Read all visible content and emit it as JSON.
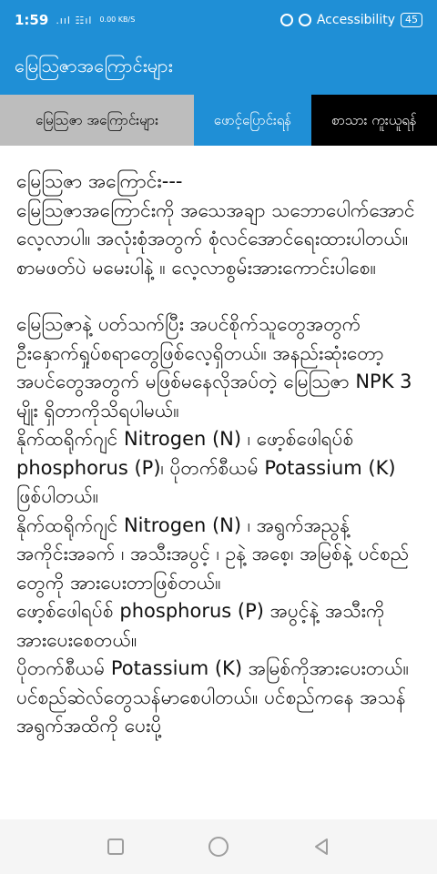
{
  "status_bar": {
    "time": "1:59",
    "signal": ".ııl ☷ıl",
    "speed": "0.00 KB/S",
    "accessibility_label": "Accessibility",
    "battery": "45"
  },
  "app_bar": {
    "title": "မြေဩဇာအကြောင်းများ"
  },
  "tabs": [
    {
      "label": "မြေဩဇာ အကြောင်းများ"
    },
    {
      "label": "ဖောင့်ပြောင်းရန်"
    },
    {
      "label": "စာသား ကူးယူရန်"
    }
  ],
  "article": {
    "paragraphs": [
      "မြေဩဇာ အကြောင်း---",
      "မြေဩဇာအကြောင်းကို အသေအချာ သဘောပေါက်အောင်လေ့လာပါ။ အလုံးစုံအတွက် စုံလင်အောင်ရေးထားပါတယ်။ စာမဖတ်ပဲ မမေးပါနဲ့ ။ လေ့လာစွမ်းအားကောင်းပါစေ။",
      "",
      "မြေဩဇာနဲ့ ပတ်သက်ပြီး အပင်စိုက်သူတွေအတွက် ဦးနှောက်ရှုပ်စရာတွေဖြစ်လေ့ရှိတယ်။ အနည်းဆုံးတော့ အပင်တွေအတွက် မဖြစ်မနေလိုအပ်တဲ့ မြေဩဇာ NPK 3 မျိုး ရှိတာကိုသိရပါမယ်။",
      "နိုက်ထရိုက်ဂျင် Nitrogen (N) ၊ ဖော့စ်ဖေါရပ်စ် phosphorus (P)၊ ပိုတက်စီယမ် Potassium (K) ဖြစ်ပါတယ်။",
      "နိုက်ထရိုက်ဂျင် Nitrogen (N) ၊ အရွက်အညွန့်အကိုင်းအခက် ၊ အသီးအပွင့် ၊ ဥနဲ့ အစေ့၊ အမြစ်နဲ့ ပင်စည်တွေကို အားပေးတာဖြစ်တယ်။",
      "ဖော့စ်ဖေါရပ်စ် phosphorus (P) အပွင့်နဲ့ အသီးကိုအားပေးစေတယ်။",
      "ပိုတက်စီယမ် Potassium (K) အမြစ်ကိုအားပေးတယ်။ ပင်စည်ဆဲလ်တွေသန်မာစေပါတယ်။ ပင်စည်ကနေ အသန် အရွက်အထိကို ပေးပို့"
    ]
  }
}
